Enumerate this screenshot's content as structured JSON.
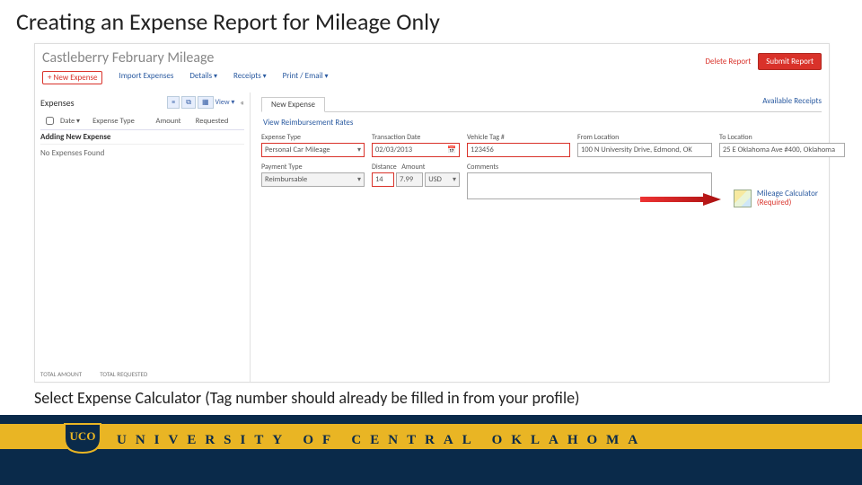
{
  "slide": {
    "title": "Creating an Expense Report for Mileage Only",
    "caption": "Select Expense Calculator (Tag number should already be filled in from your profile)"
  },
  "concur": {
    "report_title": "Castleberry February Mileage",
    "top_links": {
      "delete": "Delete Report",
      "submit": "Submit Report"
    },
    "menu": {
      "new_expense": "+ New Expense",
      "import": "Import Expenses",
      "details": "Details",
      "receipts": "Receipts",
      "print": "Print / Email"
    },
    "left": {
      "section": "Expenses",
      "view_label": "View",
      "cols": {
        "date": "Date",
        "type": "Expense Type",
        "amount": "Amount",
        "requested": "Requested"
      },
      "adding": "Adding New Expense",
      "empty": "No Expenses Found",
      "totals": {
        "amount_label": "TOTAL AMOUNT",
        "requested_label": "TOTAL REQUESTED"
      }
    },
    "right": {
      "tab": "New Expense",
      "available": "Available Receipts",
      "view_reimb": "View Reimbursement Rates",
      "labels": {
        "expense_type": "Expense Type",
        "transaction_date": "Transaction Date",
        "vehicle_tag": "Vehicle Tag #",
        "from_loc": "From Location",
        "to_loc": "To Location",
        "payment_type": "Payment Type",
        "distance": "Distance",
        "amount": "Amount",
        "comments": "Comments"
      },
      "values": {
        "expense_type": "Personal Car Mileage",
        "transaction_date": "02/03/2013",
        "vehicle_tag": "123456",
        "from_loc": "100 N University Drive, Edmond, OK",
        "to_loc": "25 E Oklahoma Ave #400, Oklahoma",
        "payment_type": "Reimbursable",
        "distance": "14",
        "rate": "7.99",
        "currency": "USD"
      },
      "mileage": {
        "label": "Mileage Calculator",
        "required": "(Required)"
      }
    }
  },
  "footer": {
    "university": "UNIVERSITY OF CENTRAL OKLAHOMA",
    "logo_text": "UCO"
  }
}
